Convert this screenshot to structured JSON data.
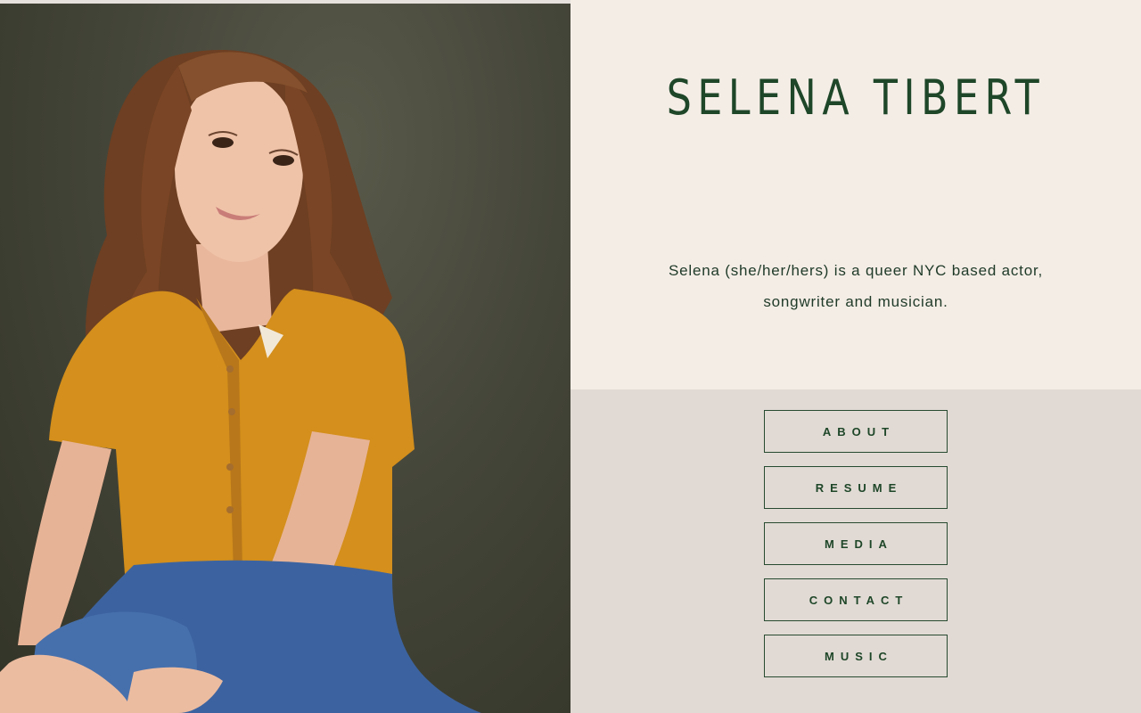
{
  "site": {
    "title": "SELENA TIBERT",
    "bio_line1": "Selena (she/her/hers) is a queer NYC based actor,",
    "bio_line2": "songwriter and musician."
  },
  "nav": {
    "items": [
      {
        "label": "ABOUT"
      },
      {
        "label": "RESUME"
      },
      {
        "label": "MEDIA"
      },
      {
        "label": "CONTACT"
      },
      {
        "label": "MUSIC"
      }
    ]
  },
  "colors": {
    "title_green": "#1e4628",
    "intro_bg": "#f4ede6",
    "nav_bg": "#e1dad4",
    "photo_backdrop": "#45463a",
    "shirt": "#d48f1c",
    "jeans": "#3c63a0"
  },
  "photo": {
    "icon": "portrait-photo"
  }
}
